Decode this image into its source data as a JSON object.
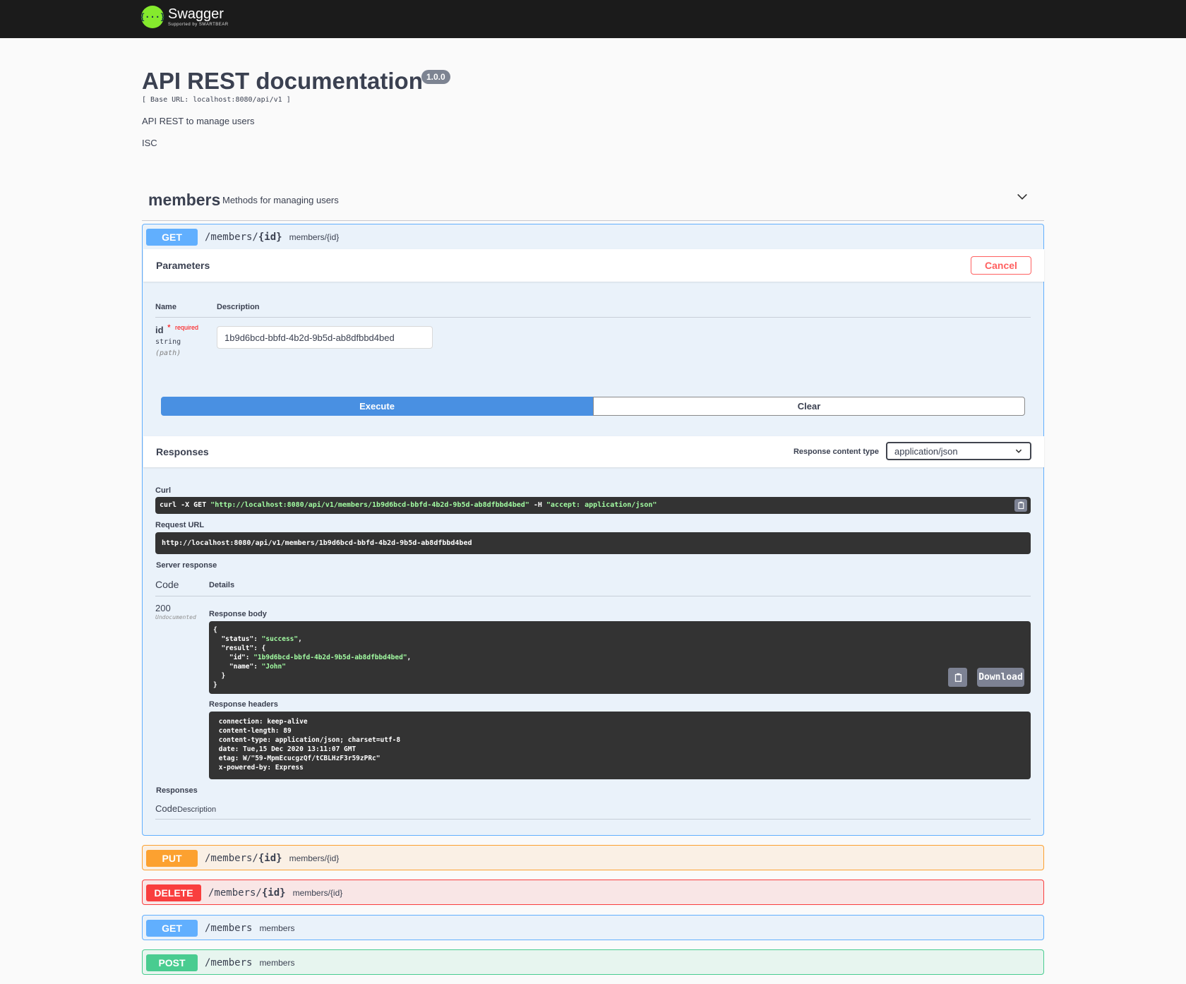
{
  "brand": {
    "logo_mark": "{···}",
    "name": "Swagger",
    "sub": "Supported by SMARTBEAR"
  },
  "info": {
    "title": "API REST documentation",
    "version": "1.0.0",
    "base_url": "[ Base URL: localhost:8080/api/v1 ]",
    "description": "API REST to manage users",
    "contact": "ISC"
  },
  "tag": {
    "name": "members",
    "description": "Methods for managing users"
  },
  "expanded_op": {
    "method": "GET",
    "path": "/members/",
    "path_param": "{id}",
    "summary": "members/{id}",
    "parameters_title": "Parameters",
    "cancel_label": "Cancel",
    "col_name": "Name",
    "col_description": "Description",
    "param": {
      "name": "id",
      "required_star": "*",
      "required_label": "required",
      "type": "string",
      "location": "(path)",
      "value": "1b9d6bcd-bbfd-4b2d-9b5d-ab8dfbbd4bed"
    },
    "execute_label": "Execute",
    "clear_label": "Clear",
    "responses_title": "Responses",
    "content_type_label": "Response content type",
    "content_type_value": "application/json",
    "curl_label": "Curl",
    "curl": {
      "prefix": "curl -X GET ",
      "url": "\"http://localhost:8080/api/v1/members/1b9d6bcd-bbfd-4b2d-9b5d-ab8dfbbd4bed\"",
      "flag": " -H  ",
      "header": "\"accept: application/json\""
    },
    "request_url_label": "Request URL",
    "request_url": "http://localhost:8080/api/v1/members/1b9d6bcd-bbfd-4b2d-9b5d-ab8dfbbd4bed",
    "server_response_label": "Server response",
    "code_label": "Code",
    "details_label": "Details",
    "status_code": "200",
    "status_note": "Undocumented",
    "response_body_label": "Response body",
    "response_body": {
      "line1": "{",
      "status_key": "  \"status\": ",
      "status_val": "\"success\"",
      "result_key": "  \"result\": {",
      "id_key": "    \"id\": ",
      "id_val": "\"1b9d6bcd-bbfd-4b2d-9b5d-ab8dfbbd4bed\"",
      "name_key": "    \"name\": ",
      "name_val": "\"John\"",
      "close_inner": "  }",
      "close_outer": "}"
    },
    "download_label": "Download",
    "response_headers_label": "Response headers",
    "response_headers": [
      " connection: keep-alive ",
      " content-length: 89 ",
      " content-type: application/json; charset=utf-8 ",
      " date: Tue,15 Dec 2020 13:11:07 GMT ",
      " etag: W/\"59-MpmEcucgzQf/tCBLHzF3r59zPRc\" ",
      " x-powered-by: Express "
    ],
    "responses_label": "Responses",
    "resp_code_label": "Code",
    "resp_desc_label": "Description"
  },
  "operations": [
    {
      "method": "PUT",
      "path": "/members/",
      "path_param": "{id}",
      "summary": "members/{id}"
    },
    {
      "method": "DELETE",
      "path": "/members/",
      "path_param": "{id}",
      "summary": "members/{id}"
    },
    {
      "method": "GET",
      "path": "/members",
      "path_param": "",
      "summary": "members"
    },
    {
      "method": "POST",
      "path": "/members",
      "path_param": "",
      "summary": "members"
    }
  ],
  "colors": {
    "get": "#61affe",
    "put": "#fca130",
    "delete": "#f93e3e",
    "post": "#49cc90",
    "execute": "#4990e2",
    "cancel": "#ff6060"
  },
  "icons": {
    "tag_toggle": "chevron-down-icon",
    "select": "chevron-down-icon",
    "copy": "clipboard-icon"
  }
}
